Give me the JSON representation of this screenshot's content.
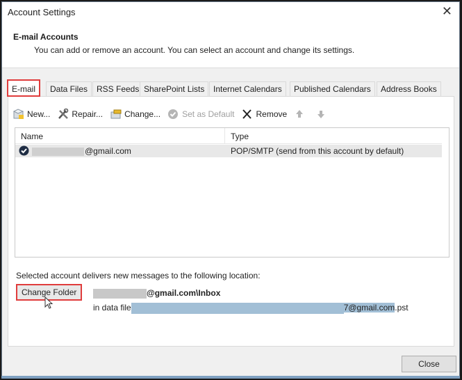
{
  "window": {
    "title": "Account Settings",
    "close_glyph": "✕"
  },
  "header": {
    "title": "E-mail Accounts",
    "subtitle": "You can add or remove an account. You can select an account and change its settings."
  },
  "tabs": [
    {
      "label": "E-mail",
      "active": true
    },
    {
      "label": "Data Files",
      "active": false
    },
    {
      "label": "RSS Feeds",
      "active": false
    },
    {
      "label": "SharePoint Lists",
      "active": false
    },
    {
      "label": "Internet Calendars",
      "active": false
    },
    {
      "label": "Published Calendars",
      "active": false
    },
    {
      "label": "Address Books",
      "active": false
    }
  ],
  "toolbar": {
    "new_label": "New...",
    "repair_label": "Repair...",
    "change_label": "Change...",
    "set_default_label": "Set as Default",
    "remove_label": "Remove",
    "icons": [
      "new-account-icon",
      "repair-tools-icon",
      "change-icon",
      "checkmark-circle-icon",
      "x-remove-icon",
      "arrow-up-icon",
      "arrow-down-icon"
    ]
  },
  "account_list": {
    "columns": [
      "Name",
      "Type"
    ],
    "rows": [
      {
        "name_suffix": "@gmail.com",
        "type": "POP/SMTP (send from this account by default)",
        "default": true,
        "selected": true
      }
    ]
  },
  "delivery": {
    "label": "Selected account delivers new messages to the following location:",
    "change_folder_label": "Change Folder",
    "folder_suffix": "@gmail.com\\Inbox",
    "data_file_prefix": "in data file",
    "data_file_suffix_highlight": "7@gmail.com",
    "data_file_ext": ".pst"
  },
  "footer": {
    "close_label": "Close"
  },
  "colors": {
    "highlight_box": "#e03c3c",
    "selection_blue": "#a2bfd6",
    "dialog_bg": "#f0f0f0"
  }
}
